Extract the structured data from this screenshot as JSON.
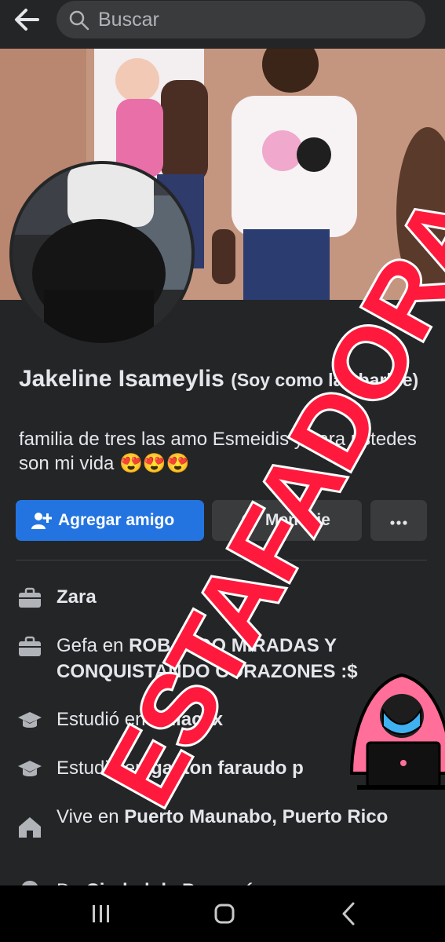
{
  "header": {
    "search_placeholder": "Buscar"
  },
  "profile": {
    "name": "Jakeline Isameylis",
    "name_suffix": "(Soy como las barbie)",
    "bio": "familia de tres las amo Esmeidis y sara ustedes son mi vida 😍😍😍"
  },
  "actions": {
    "add_friend": "Agregar amigo",
    "message": "Mensaje"
  },
  "details": [
    {
      "icon": "briefcase-icon",
      "prefix": "",
      "bold": "Zara"
    },
    {
      "icon": "briefcase-icon",
      "prefix": "Gefa en ",
      "bold": "ROBANDO MIRADAS Y CONQUISTANDO CORAZONES :$"
    },
    {
      "icon": "graduation-cap-icon",
      "prefix": "Estudió en ",
      "bold": "Unlacex"
    },
    {
      "icon": "graduation-cap-icon",
      "prefix": "Estudió en ",
      "bold": "gaston faraudo p"
    },
    {
      "icon": "home-icon",
      "prefix": "Vive en ",
      "bold": "Puerto Maunabo, Puerto Rico"
    },
    {
      "icon": "location-pin-icon",
      "prefix": "De ",
      "bold": "Ciudad de Panamá"
    }
  ],
  "overlay": {
    "stamp": "ESTAFADORA"
  },
  "colors": {
    "background": "#242526",
    "primary": "#2374e1",
    "secondary_button": "#3a3b3c",
    "stamp": "#ff1a3d"
  }
}
